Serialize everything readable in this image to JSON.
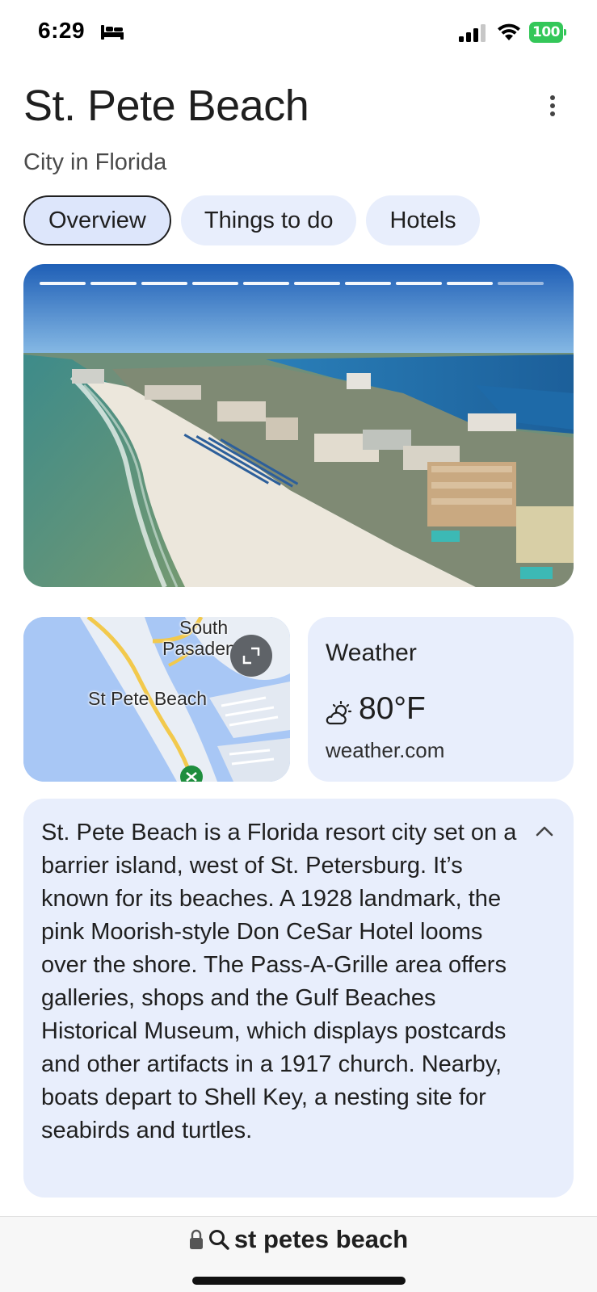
{
  "status_bar": {
    "time": "6:29",
    "battery": "100"
  },
  "header": {
    "title": "St. Pete Beach",
    "subtitle": "City in Florida"
  },
  "tabs": [
    {
      "label": "Overview",
      "active": true
    },
    {
      "label": "Things to do",
      "active": false
    },
    {
      "label": "Hotels",
      "active": false
    }
  ],
  "gallery": {
    "total_images": 10,
    "current_index": 10
  },
  "map": {
    "labels": [
      "South",
      "Pasadena",
      "St Pete Beach"
    ]
  },
  "weather": {
    "title": "Weather",
    "temperature": "80°F",
    "source": "weather.com",
    "icon": "partly-cloudy-icon"
  },
  "description": {
    "text": "St. Pete Beach is a Florida resort city set on a barrier island, west of St. Petersburg. It’s known for its beaches. A 1928 landmark, the pink Moorish-style Don CeSar Hotel looms over the shore. The Pass-A-Grille area offers galleries, shops and the Gulf Beaches Historical Museum, which displays postcards and other artifacts in a 1917 church. Nearby, boats depart to Shell Key, a nesting site for seabirds and turtles."
  },
  "address_bar": {
    "query": "st petes beach"
  },
  "colors": {
    "card_bg": "#e8eefc",
    "battery": "#34c759",
    "map_water": "#a8c7f5"
  }
}
